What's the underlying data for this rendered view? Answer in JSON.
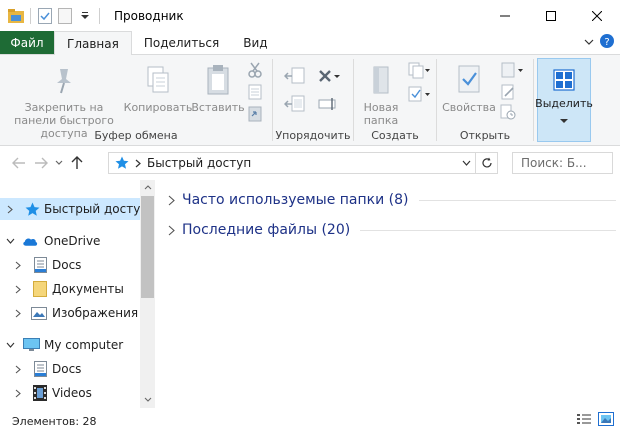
{
  "window": {
    "title": "Проводник"
  },
  "tabs": [
    {
      "label": "Файл"
    },
    {
      "label": "Главная"
    },
    {
      "label": "Поделиться"
    },
    {
      "label": "Вид"
    }
  ],
  "ribbon": {
    "clipboard": {
      "pin_label": "Закрепить на панели быстрого доступа",
      "copy_label": "Копировать",
      "paste_label": "Вставить",
      "group_label": "Буфер обмена"
    },
    "organize": {
      "group_label": "Упорядочить"
    },
    "create": {
      "new_folder_label": "Новая папка",
      "group_label": "Создать"
    },
    "open": {
      "properties_label": "Свойства",
      "group_label": "Открыть"
    },
    "select": {
      "label": "Выделить"
    }
  },
  "address": {
    "path": "Быстрый доступ",
    "search_placeholder": "Поиск: Б..."
  },
  "nav_tree": [
    {
      "label": "Быстрый доступ",
      "icon": "star-icon"
    },
    {
      "label": "OneDrive",
      "icon": "cloud-icon"
    },
    {
      "label": "Docs",
      "icon": "document-icon"
    },
    {
      "label": "Документы",
      "icon": "folder-icon"
    },
    {
      "label": "Изображения",
      "icon": "picture-icon"
    },
    {
      "label": "My computer",
      "icon": "monitor-icon"
    },
    {
      "label": "Docs",
      "icon": "document-icon"
    },
    {
      "label": "Videos",
      "icon": "film-icon"
    }
  ],
  "content": {
    "frequent_folders": "Часто используемые папки (8)",
    "recent_files": "Последние файлы (20)"
  },
  "status": {
    "items_count": "Элементов: 28"
  },
  "colors": {
    "file_tab": "#1e6b35",
    "selection": "#cce8ff",
    "section_text": "#1e3287",
    "select_button": "#cde6f7"
  }
}
